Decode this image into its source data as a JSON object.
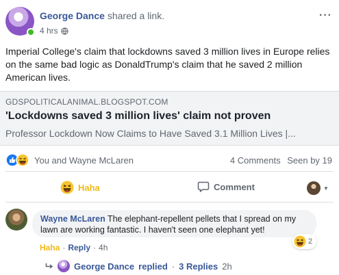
{
  "post": {
    "author": "George Dance",
    "action": "shared a link.",
    "time": "4 hrs",
    "more": "···",
    "text": "Imperial College's claim that lockdowns saved 3 million lives in Europe relies on the same bad logic as DonaldTrump's claim that he saved 2 million American lives."
  },
  "link": {
    "domain": "GDSPOLITICALANIMAL.BLOGSPOT.COM",
    "title": "'Lockdowns saved 3 million lives' claim not proven",
    "description": "Professor Lockdown Now Claims to Have Saved 3.1 Million Lives |..."
  },
  "reactions": {
    "reactors": "You and Wayne McLaren",
    "comments": "4 Comments",
    "seen": "Seen by 19"
  },
  "actions": {
    "haha": "Haha",
    "comment": "Comment"
  },
  "comment": {
    "author": "Wayne McLaren",
    "text": "The elephant-repellent pellets that I spread on my lawn are working fantastic. I haven't seen one elephant yet!",
    "reaction_count": "2",
    "haha": "Haha",
    "sep1": "·",
    "reply": "Reply",
    "sep2": "·",
    "time": "4h"
  },
  "replies": {
    "replier": "George Dance",
    "action": "replied",
    "sep1": "·",
    "count": "3 Replies",
    "time": "2h"
  },
  "colors": {
    "link_blue": "#385898",
    "haha_yellow": "#f0ba15",
    "like_blue": "#1877f2",
    "online_green": "#42b72a"
  }
}
